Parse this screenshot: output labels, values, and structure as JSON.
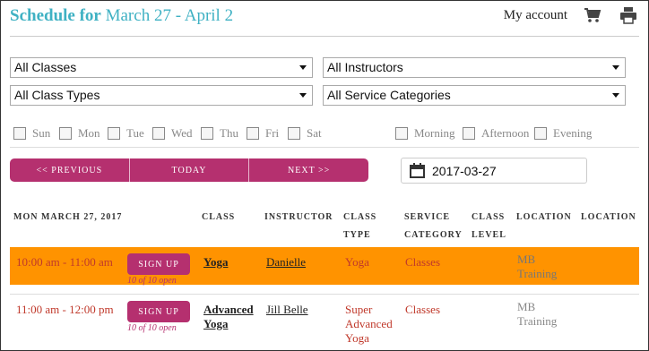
{
  "header": {
    "title_prefix": "Schedule for",
    "title_range": "March 27 - April 2",
    "my_account": "My account"
  },
  "filters": {
    "classes": "All Classes",
    "instructors": "All Instructors",
    "class_types": "All Class Types",
    "service_categories": "All Service Categories"
  },
  "days": [
    "Sun",
    "Mon",
    "Tue",
    "Wed",
    "Thu",
    "Fri",
    "Sat"
  ],
  "times_of_day": [
    "Morning",
    "Afternoon",
    "Evening"
  ],
  "nav": {
    "previous": "<< PREVIOUS",
    "today": "TODAY",
    "next": "NEXT >>",
    "date": "2017-03-27"
  },
  "table": {
    "headers": {
      "date": "MON MARCH 27, 2017",
      "class": "CLASS",
      "instructor": "INSTRUCTOR",
      "class_type": "CLASS TYPE",
      "service_category": "SERVICE CATEGORY",
      "class_level": "CLASS LEVEL",
      "location": "LOCATION",
      "location2": "LOCATION"
    },
    "rows": [
      {
        "time": "10:00 am - 11:00 am",
        "signup": "SIGN UP",
        "open": "10 of 10 open",
        "class": "Yoga",
        "instructor": "Danielle",
        "class_type": "Yoga",
        "service_category": "Classes",
        "location": "MB Training"
      },
      {
        "time": "11:00 am - 12:00 pm",
        "signup": "SIGN UP",
        "open": "10 of 10 open",
        "class": "Advanced Yoga",
        "instructor": "Jill Belle",
        "class_type": "Super Advanced Yoga",
        "service_category": "Classes",
        "location": "MB Training"
      }
    ]
  },
  "colors": {
    "accent": "#b5306f",
    "title": "#3fb1c3",
    "highlight_row": "#ff9300",
    "time_text": "#c0392b"
  },
  "icons": [
    "cart-icon",
    "print-icon",
    "calendar-icon",
    "chevron-down-icon"
  ]
}
